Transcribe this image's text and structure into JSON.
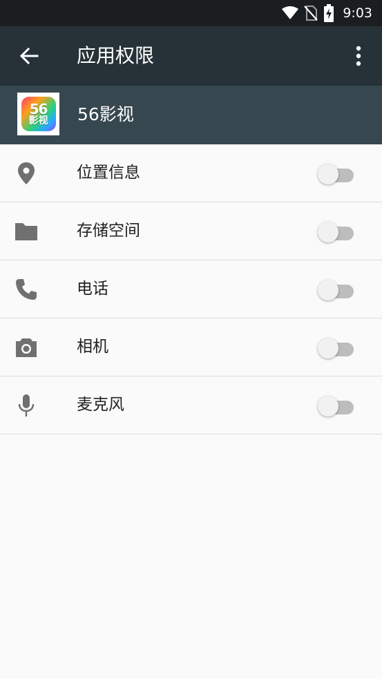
{
  "status_bar": {
    "time": "9:03"
  },
  "app_bar": {
    "title": "应用权限"
  },
  "app": {
    "name": "56影视",
    "logo_number": "56",
    "logo_text": "影视"
  },
  "permissions": [
    {
      "label": "位置信息",
      "icon": "location-pin-icon",
      "enabled": false
    },
    {
      "label": "存储空间",
      "icon": "folder-icon",
      "enabled": false
    },
    {
      "label": "电话",
      "icon": "phone-icon",
      "enabled": false
    },
    {
      "label": "相机",
      "icon": "camera-icon",
      "enabled": false
    },
    {
      "label": "麦克风",
      "icon": "microphone-icon",
      "enabled": false
    }
  ],
  "colors": {
    "status_bar": "#1a1e21",
    "app_bar": "#263238",
    "app_header": "#37474f",
    "background": "#fafafa",
    "icon": "#707070"
  }
}
